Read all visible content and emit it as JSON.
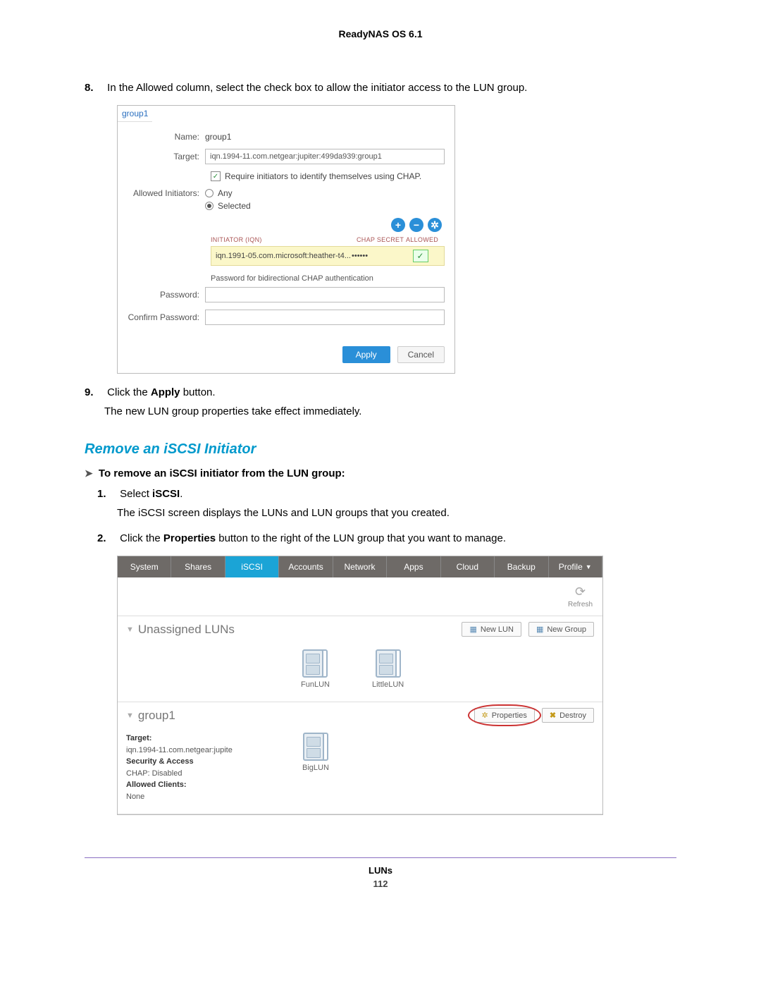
{
  "page_header": "ReadyNAS OS 6.1",
  "step8": {
    "num": "8.",
    "text": "In the Allowed column, select the check box to allow the initiator access to the LUN group."
  },
  "dialog": {
    "tab": "group1",
    "name_label": "Name:",
    "name_value": "group1",
    "target_label": "Target:",
    "target_value": "iqn.1994-11.com.netgear:jupiter:499da939:group1",
    "chap_checkbox": "Require initiators to identify themselves using CHAP.",
    "allowed_label": "Allowed Initiators:",
    "radio_any": "Any",
    "radio_selected": "Selected",
    "col_iqn": "INITIATOR (IQN)",
    "col_secret": "CHAP SECRET",
    "col_allowed": "ALLOWED",
    "row_iqn": "iqn.1991-05.com.microsoft:heather-t4...",
    "row_secret": "••••••",
    "pwd_caption": "Password for bidirectional CHAP authentication",
    "password_label": "Password:",
    "confirm_label": "Confirm Password:",
    "apply": "Apply",
    "cancel": "Cancel"
  },
  "step9": {
    "num": "9.",
    "prefix": "Click the ",
    "bold": "Apply",
    "suffix": " button.",
    "line2": "The new LUN group properties take effect immediately."
  },
  "section_heading": "Remove an iSCSI Initiator",
  "proc_heading": "To remove an iSCSI initiator from the LUN group:",
  "sub1": {
    "num": "1.",
    "prefix": "Select ",
    "bold": "iSCSI",
    "suffix": ".",
    "line2": "The iSCSI screen displays the LUNs and LUN groups that you created."
  },
  "sub2": {
    "num": "2.",
    "prefix": "Click the ",
    "bold": "Properties",
    "suffix": " button to the right of the LUN group that you want to manage."
  },
  "app": {
    "tabs": {
      "system": "System",
      "shares": "Shares",
      "iscsi": "iSCSI",
      "accounts": "Accounts",
      "network": "Network",
      "apps": "Apps",
      "cloud": "Cloud",
      "backup": "Backup",
      "profile": "Profile"
    },
    "refresh": "Refresh",
    "unassigned": "Unassigned LUNs",
    "new_lun": "New LUN",
    "new_group": "New Group",
    "lun1": "FunLUN",
    "lun2": "LittleLUN",
    "group_name": "group1",
    "properties": "Properties",
    "destroy": "Destroy",
    "target_k": "Target:",
    "target_v": "iqn.1994-11.com.netgear:jupite",
    "sec_k": "Security & Access",
    "sec_v": "CHAP: Disabled",
    "clients_k": "Allowed Clients:",
    "clients_v": "None",
    "biglun": "BigLUN"
  },
  "footer": {
    "label": "LUNs",
    "page": "112"
  }
}
